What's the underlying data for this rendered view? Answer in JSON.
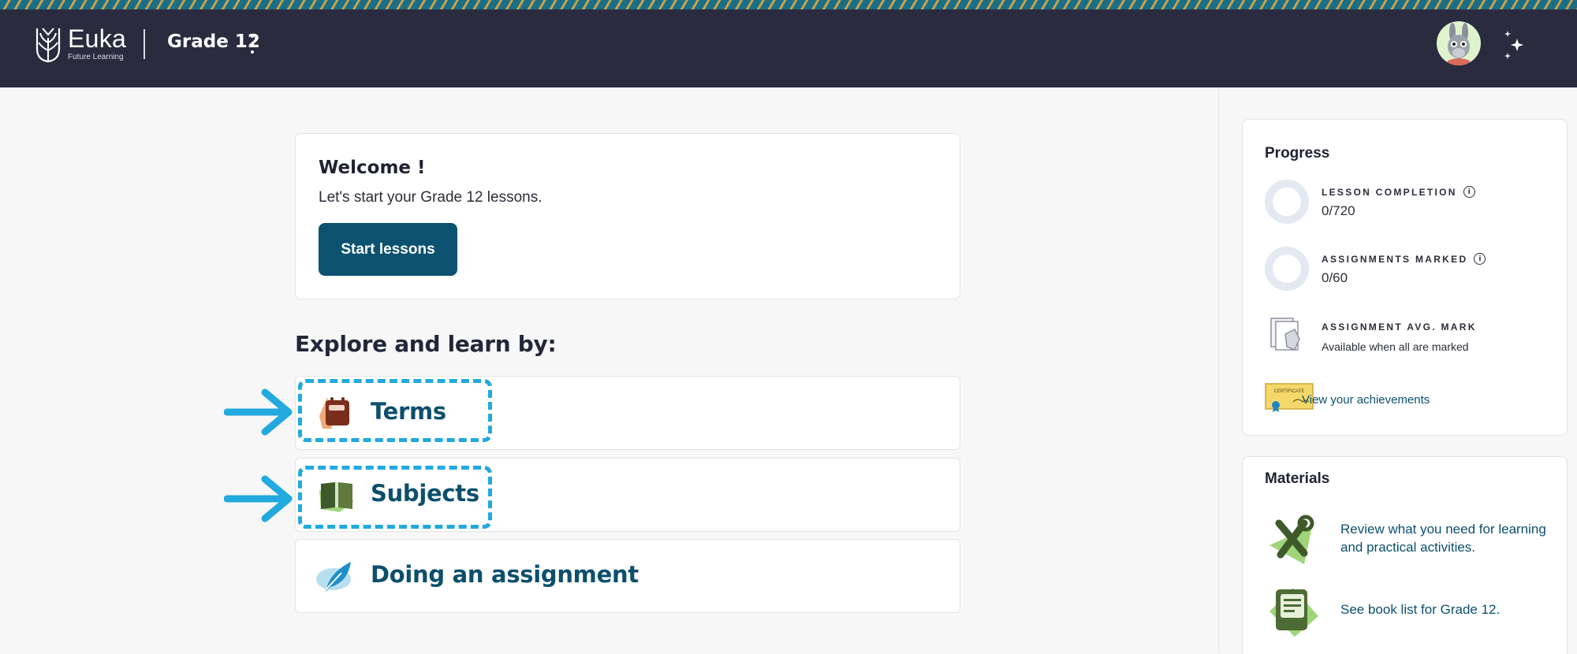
{
  "header": {
    "logo_name": "Euka",
    "logo_tagline": "Future Learning",
    "grade_title": "Grade 12"
  },
  "welcome": {
    "title": "Welcome !",
    "subtitle": "Let's start your Grade 12 lessons.",
    "start_label": "Start lessons"
  },
  "explore": {
    "heading": "Explore and learn by:",
    "items": [
      {
        "label": "Terms",
        "icon": "calendar-icon",
        "highlighted": true
      },
      {
        "label": "Subjects",
        "icon": "book-icon",
        "highlighted": true
      },
      {
        "label": "Doing an assignment",
        "icon": "feather-icon",
        "highlighted": false
      }
    ]
  },
  "progress": {
    "title": "Progress",
    "lesson_completion": {
      "label": "LESSON COMPLETION",
      "value": "0/720",
      "fraction": 0
    },
    "assignments_marked": {
      "label": "ASSIGNMENTS MARKED",
      "value": "0/60",
      "fraction": 0
    },
    "avg_mark": {
      "label": "ASSIGNMENT AVG. MARK",
      "note": "Available when all are marked"
    },
    "certificate_text": "CERTIFICATE",
    "achievements_link": "View your achievements"
  },
  "materials": {
    "title": "Materials",
    "items": [
      {
        "text": "Review what you need for learning and practical activities.",
        "icon": "tools-icon"
      },
      {
        "text": "See book list for Grade 12.",
        "icon": "book-list-icon"
      }
    ]
  },
  "colors": {
    "header_bg": "#2b2b3f",
    "accent": "#0c5270",
    "link": "#0c4f6d",
    "highlight": "#22a9dd"
  }
}
